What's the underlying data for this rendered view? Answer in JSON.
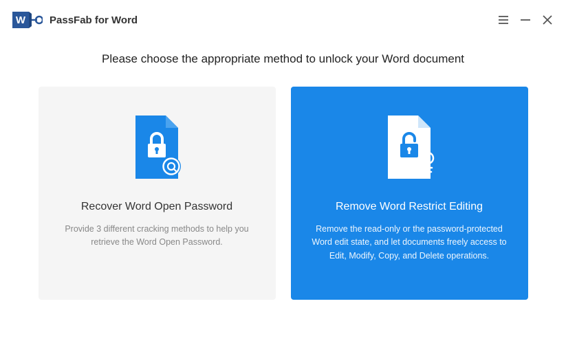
{
  "app": {
    "title": "PassFab for Word"
  },
  "heading": "Please choose the appropriate method to unlock your Word document",
  "cards": {
    "recover": {
      "title": "Recover Word Open Password",
      "desc": "Provide 3 different cracking methods to help you retrieve the Word Open Password."
    },
    "remove": {
      "title": "Remove Word Restrict Editing",
      "desc": "Remove the read-only or the password-protected Word edit state, and let documents freely access to Edit, Modify, Copy, and Delete operations."
    }
  },
  "colors": {
    "accent": "#1a87e8",
    "cardGray": "#f5f5f5",
    "logoBlue": "#2a579a"
  }
}
